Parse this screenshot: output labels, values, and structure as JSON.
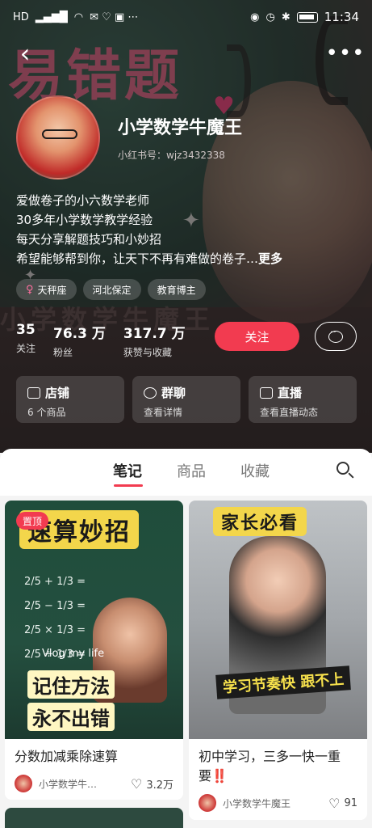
{
  "status_bar": {
    "time": "11:34",
    "left_icons": [
      "hd-icon",
      "signal-icon",
      "wifi-icon",
      "app-icons"
    ],
    "battery": "full"
  },
  "profile": {
    "nickname": "小学数学牛魔王",
    "red_id": "小红书号：wjz3432338",
    "bio": [
      "爱做卷子的小六数学老师",
      "30多年小学数学教学经验",
      "每天分享解题技巧和小妙招",
      "希望能够帮到你，让天下不再有难做的卷子…"
    ],
    "bio_more": "更多",
    "tags": [
      "天秤座",
      "河北保定",
      "教育博主"
    ],
    "stats": [
      {
        "value": "35",
        "label": "关注"
      },
      {
        "value": "76.3 万",
        "label": "粉丝"
      },
      {
        "value": "317.7 万",
        "label": "获赞与收藏"
      }
    ],
    "follow_label": "关注"
  },
  "entry_cards": [
    {
      "title": "店铺",
      "subtitle": "6 个商品",
      "icon": "store-icon"
    },
    {
      "title": "群聊",
      "subtitle": "查看详情",
      "icon": "group-chat-icon"
    },
    {
      "title": "直播",
      "subtitle": "查看直播动态",
      "icon": "live-icon"
    }
  ],
  "tabs": [
    "笔记",
    "商品",
    "收藏"
  ],
  "notes": [
    {
      "pinned_label": "置顶",
      "cover_title": "速算妙招",
      "cover_math": [
        "2/5 + 1/3 =",
        "2/5 − 1/3 =",
        "2/5 × 1/3 =",
        "2/5 ÷ 1/3 ="
      ],
      "cover_vlog": "Vlog my life",
      "cover_stickers": [
        "记住方法",
        "永不出错"
      ],
      "title": "分数加减乘除速算",
      "author": "小学数学牛…",
      "likes": "3.2万"
    },
    {
      "cover_title": "家长必看",
      "cover_caption": "学习节奏快 跟不上",
      "title": "初中学习，三多一快一重要‼️",
      "author": "小学数学牛魔王",
      "likes": "91"
    }
  ]
}
